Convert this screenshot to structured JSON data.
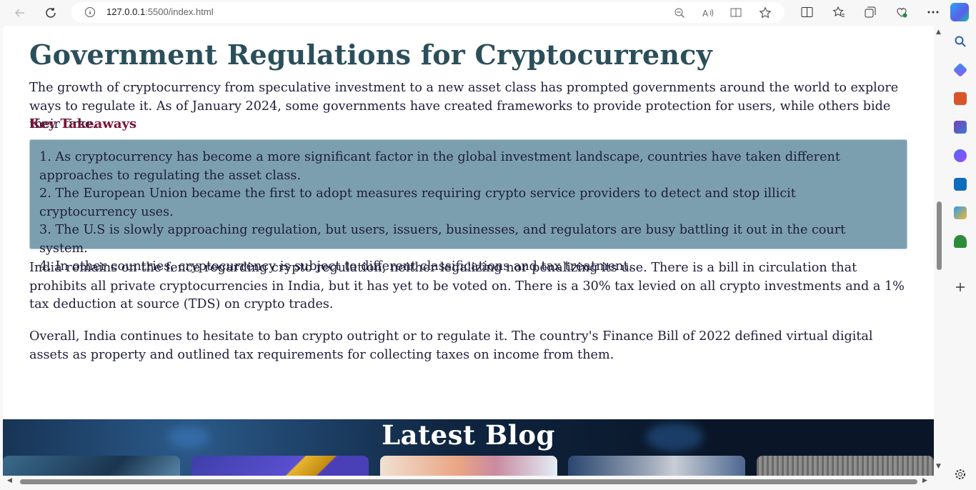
{
  "browser": {
    "url_host": "127.0.0.1",
    "url_path": ":5500/index.html"
  },
  "article": {
    "title": "Government Regulations for Cryptocurrency",
    "intro": "The growth of cryptocurrency from speculative investment to a new asset class has prompted governments around the world to explore ways to regulate it. As of January 2024, some governments have created frameworks to provide protection for users, while others bide their time.",
    "key_takeaways_heading": "Key Takeaways",
    "takeaways": [
      "1. As cryptocurrency has become a more significant factor in the global investment landscape, countries have taken different approaches to regulating the asset class.",
      "2. The European Union became the first to adopt measures requiring crypto service providers to detect and stop illicit cryptocurrency uses.",
      "3. The U.S is slowly approaching regulation, but users, issuers, businesses, and regulators are busy battling it out in the court system.",
      "4. In other countries, cryptocurrency is subject to different classifications and tax treatment."
    ],
    "india_paragraph": "India remains on the fence regarding crypto regulation, neither legalizing nor penalizing its use. There is a bill in circulation that prohibits all private cryptocurrencies in India, but it has yet to be voted on. There is a 30% tax levied on all crypto investments and a 1% tax deduction at source (TDS) on crypto trades.",
    "overall_paragraph": "Overall, India continues to hesitate to ban crypto outright or to regulate it. The country's Finance Bill of 2022 defined virtual digital assets as property and outlined tax requirements for collecting taxes on income from them."
  },
  "blog": {
    "heading": "Latest Blog"
  },
  "colors": {
    "title": "#2b4f5a",
    "key_takeaways": "#7a1436",
    "takeaway_box": "#7c9fb0"
  }
}
